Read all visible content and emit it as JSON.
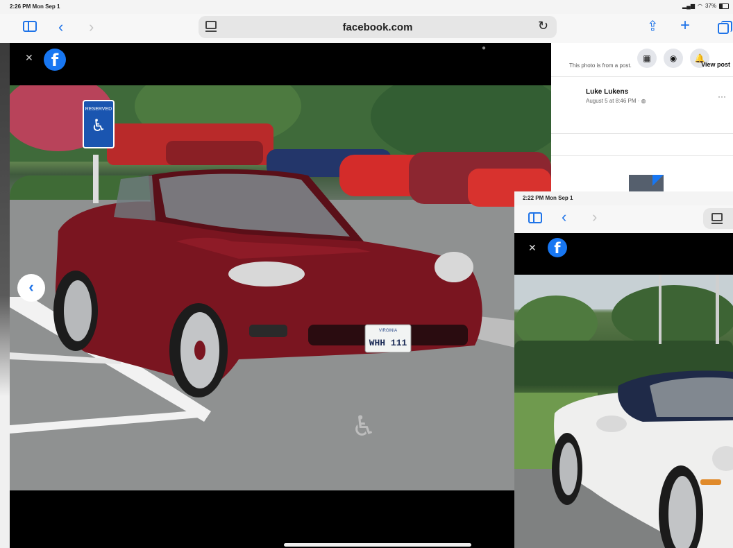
{
  "status_bar": {
    "time": "2:26 PM  Mon Sep 1",
    "battery": "37%"
  },
  "toolbar": {
    "url": "facebook.com"
  },
  "viewer": {
    "license_plate_state": "VIRGINIA",
    "license_plate": "WHH 111",
    "sign_text": "RESERVED"
  },
  "panel": {
    "notice": "This photo is from a post.",
    "view_post": "View post",
    "author": "Luke Lukens",
    "date": "August 5 at 8:46 PM · "
  },
  "inset": {
    "status_time": "2:22 PM  Mon Sep 1"
  },
  "colors": {
    "accent": "#1e73e8",
    "facebook_blue": "#1877f2",
    "car_red": "#7a1520",
    "car_white": "#efefee"
  }
}
